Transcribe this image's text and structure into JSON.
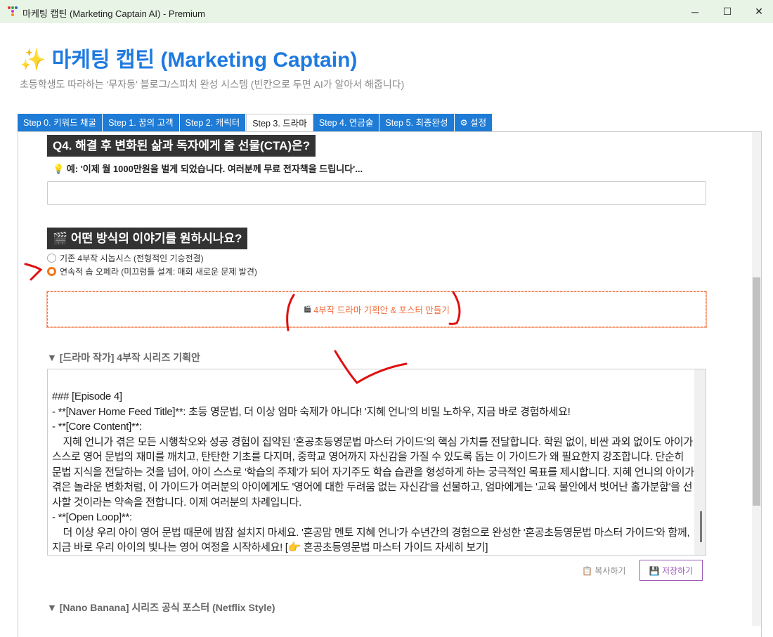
{
  "window": {
    "title": "마케팅 캡틴 (Marketing Captain AI) - Premium",
    "controls": {
      "minimize": "─",
      "maximize": "☐",
      "close": "✕"
    }
  },
  "header": {
    "icon": "✨",
    "title": "마케팅 캡틴 (Marketing Captain)",
    "subtitle": "초등학생도 따라하는 '무자동' 블로그/스피치 완성 시스템 (빈칸으로 두면 AI가 알아서 해줍니다)"
  },
  "tabs": [
    {
      "label": "Step 0. 키워드 채굴",
      "active": false
    },
    {
      "label": "Step 1. 꿈의 고객",
      "active": false
    },
    {
      "label": "Step 2. 캐릭터",
      "active": false
    },
    {
      "label": "Step 3. 드라마",
      "active": true
    },
    {
      "label": "Step 4. 연금술",
      "active": false
    },
    {
      "label": "Step 5. 최종완성",
      "active": false
    },
    {
      "label": "⚙ 설정",
      "active": false
    }
  ],
  "q4": {
    "title": "Q4. 해결 후 변화된 삶과 독자에게 줄 선물(CTA)은?",
    "hint_icon": "💡",
    "hint": "예: '이제 월 1000만원을 벌게 되었습니다. 여러분께 무료 전자책을 드립니다'...",
    "value": ""
  },
  "story": {
    "icon": "🎬",
    "title": "어떤 방식의 이야기를 원하시나요?",
    "options": [
      {
        "label": "기존 4부작 시놉시스 (전형적인 기승전결)",
        "selected": false
      },
      {
        "label": "연속적 솝 오페라 (미끄럼틀 설계: 매회 새로운 문제 발견)",
        "selected": true
      }
    ]
  },
  "generate_button": {
    "icon": "🎬",
    "label": "4부작 드라마 기획안 & 포스터 만들기",
    "color": "#f07040"
  },
  "plan_section": {
    "title": "▼ [드라마 작가] 4부작 시리즈 기획안",
    "content": "### [Episode 4]\n- **[Naver Home Feed Title]**: 초등 영문법, 더 이상 엄마 숙제가 아니다! '지혜 언니'의 비밀 노하우, 지금 바로 경험하세요!\n- **[Core Content]**:\n    지혜 언니가 겪은 모든 시행착오와 성공 경험이 집약된 '혼공초등영문법 마스터 가이드'의 핵심 가치를 전달합니다. 학원 없이, 비싼 과외 없이도 아이가 스스로 영어 문법의 재미를 깨치고, 탄탄한 기초를 다지며, 중학교 영어까지 자신감을 가질 수 있도록 돕는 이 가이드가 왜 필요한지 강조합니다. 단순히 문법 지식을 전달하는 것을 넘어, 아이 스스로 '학습의 주체'가 되어 자기주도 학습 습관을 형성하게 하는 궁극적인 목표를 제시합니다. 지혜 언니의 아이가 겪은 놀라운 변화처럼, 이 가이드가 여러분의 아이에게도 '영어에 대한 두려움 없는 자신감'을 선물하고, 엄마에게는 '교육 불안에서 벗어난 홀가분함'을 선사할 것이라는 약속을 전합니다. 이제 여러분의 차례입니다.\n- **[Open Loop]**:\n    더 이상 우리 아이 영어 문법 때문에 밤잠 설치지 마세요. '혼공맘 멘토 지혜 언니'가 수년간의 경험으로 완성한 '혼공초등영문법 마스터 가이드'와 함께, 지금 바로 우리 아이의 빛나는 영어 여정을 시작하세요! [👉 혼공초등영문법 마스터 가이드 자세히 보기]",
    "copy_label": "📋 복사하기",
    "save_label": "💾 저장하기"
  },
  "poster_section": {
    "title": "▼ [Nano Banana] 시리즈 공식 포스터 (Netflix Style)"
  },
  "colors": {
    "accent": "#1f7ae0",
    "tab": "#1e7bd6",
    "heading_bg": "#333333",
    "save": "#9b59b6",
    "annotation": "#e01010"
  }
}
